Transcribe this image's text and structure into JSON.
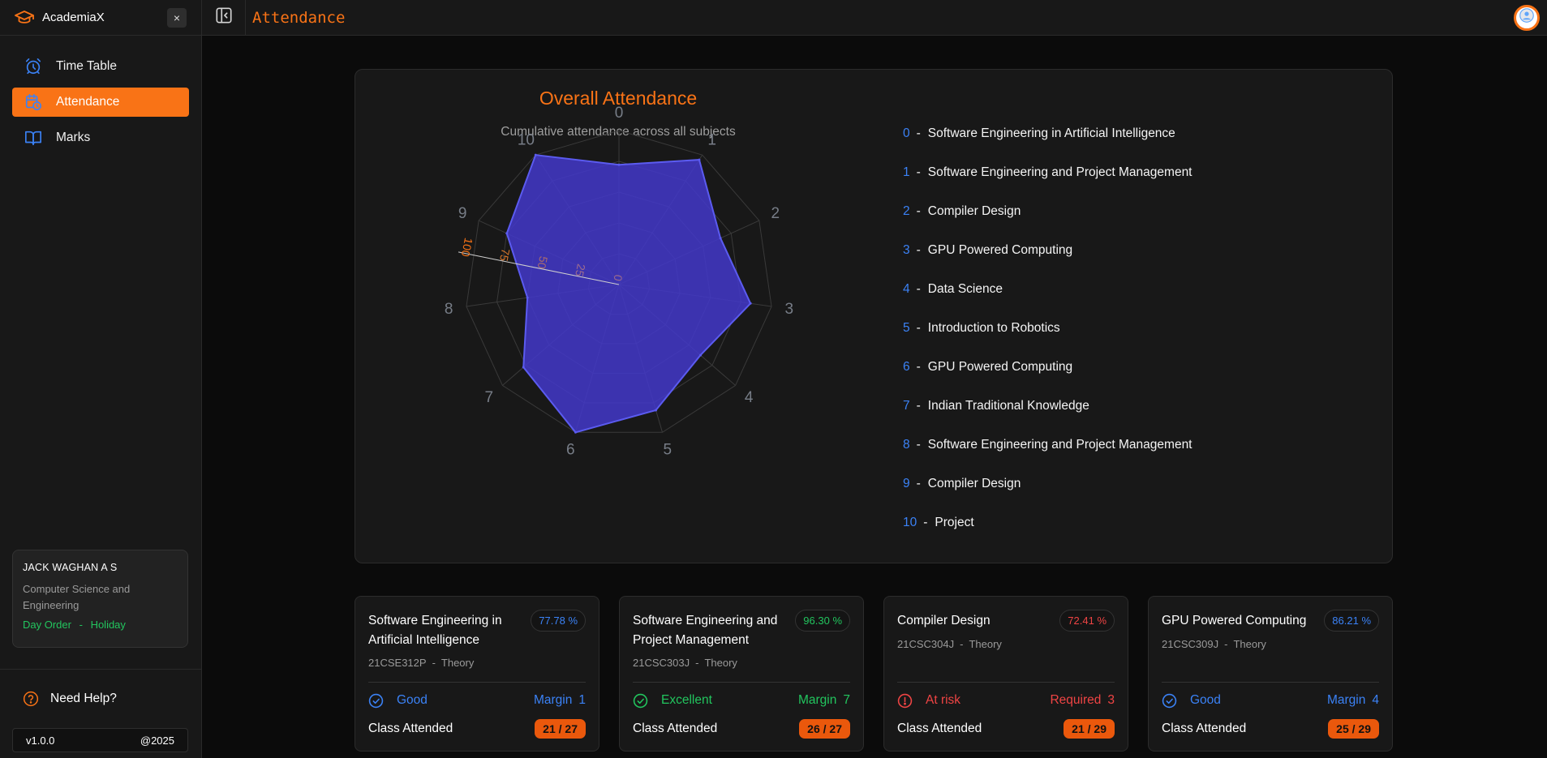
{
  "app": {
    "name": "AcademiaX",
    "close_label": "×"
  },
  "header": {
    "title": "Attendance"
  },
  "sidebar": {
    "items": [
      {
        "label": "Time Table",
        "icon": "alarm-clock-icon",
        "active": false
      },
      {
        "label": "Attendance",
        "icon": "calendar-clock-icon",
        "active": true
      },
      {
        "label": "Marks",
        "icon": "book-open-icon",
        "active": false
      }
    ],
    "user": {
      "name": "JACK WAGHAN A S",
      "department": "Computer Science and Engineering",
      "day_order_label": "Day Order",
      "day_order_sep": "-",
      "day_order_value": "Holiday"
    },
    "help_label": "Need Help?",
    "version": "v1.0.0",
    "year": "@2025"
  },
  "chart": {
    "title": "Overall Attendance",
    "subtitle": "Cumulative attendance across all subjects",
    "axis_ticks": [
      "0",
      "25",
      "50",
      "75",
      "100"
    ],
    "legend": [
      {
        "index": "0",
        "label": "Software Engineering in Artificial Intelligence"
      },
      {
        "index": "1",
        "label": "Software Engineering and Project Management"
      },
      {
        "index": "2",
        "label": "Compiler Design"
      },
      {
        "index": "3",
        "label": "GPU Powered Computing"
      },
      {
        "index": "4",
        "label": "Data Science"
      },
      {
        "index": "5",
        "label": "Introduction to Robotics"
      },
      {
        "index": "6",
        "label": "GPU Powered Computing"
      },
      {
        "index": "7",
        "label": "Indian Traditional Knowledge"
      },
      {
        "index": "8",
        "label": "Software Engineering and Project Management"
      },
      {
        "index": "9",
        "label": "Compiler Design"
      },
      {
        "index": "10",
        "label": "Project"
      }
    ]
  },
  "chart_data": {
    "type": "radar",
    "title": "Overall Attendance",
    "subtitle": "Cumulative attendance across all subjects",
    "categories": [
      "0",
      "1",
      "2",
      "3",
      "4",
      "5",
      "6",
      "7",
      "8",
      "9",
      "10"
    ],
    "values": [
      77.78,
      96.3,
      72.41,
      86.21,
      70,
      85,
      100,
      82,
      60,
      80,
      100
    ],
    "rlim": [
      0,
      100
    ],
    "rticks": [
      0,
      25,
      50,
      75,
      100
    ],
    "fill_color": "#4338ca",
    "stroke_color": "#5b5bf0"
  },
  "subjects": [
    {
      "name": "Software Engineering in Artificial Intelligence",
      "percent": "77.78 %",
      "percent_color": "#3b82f6",
      "code": "21CSE312P",
      "type": "Theory",
      "status": "Good",
      "status_icon": "check-circle-icon",
      "status_color": "#3b82f6",
      "metric_label": "Margin",
      "metric_value": "1",
      "attended_label": "Class Attended",
      "attended": "21 / 27"
    },
    {
      "name": "Software Engineering and Project Management",
      "percent": "96.30 %",
      "percent_color": "#22c55e",
      "code": "21CSC303J",
      "type": "Theory",
      "status": "Excellent",
      "status_icon": "check-circle-icon",
      "status_color": "#22c55e",
      "metric_label": "Margin",
      "metric_value": "7",
      "attended_label": "Class Attended",
      "attended": "26 / 27"
    },
    {
      "name": "Compiler Design",
      "percent": "72.41 %",
      "percent_color": "#ef4444",
      "code": "21CSC304J",
      "type": "Theory",
      "status": "At risk",
      "status_icon": "alert-circle-icon",
      "status_color": "#ef4444",
      "metric_label": "Required",
      "metric_value": "3",
      "attended_label": "Class Attended",
      "attended": "21 / 29"
    },
    {
      "name": "GPU Powered Computing",
      "percent": "86.21 %",
      "percent_color": "#3b82f6",
      "code": "21CSC309J",
      "type": "Theory",
      "status": "Good",
      "status_icon": "check-circle-icon",
      "status_color": "#3b82f6",
      "metric_label": "Margin",
      "metric_value": "4",
      "attended_label": "Class Attended",
      "attended": "25 / 29"
    }
  ],
  "code_sep": "-"
}
